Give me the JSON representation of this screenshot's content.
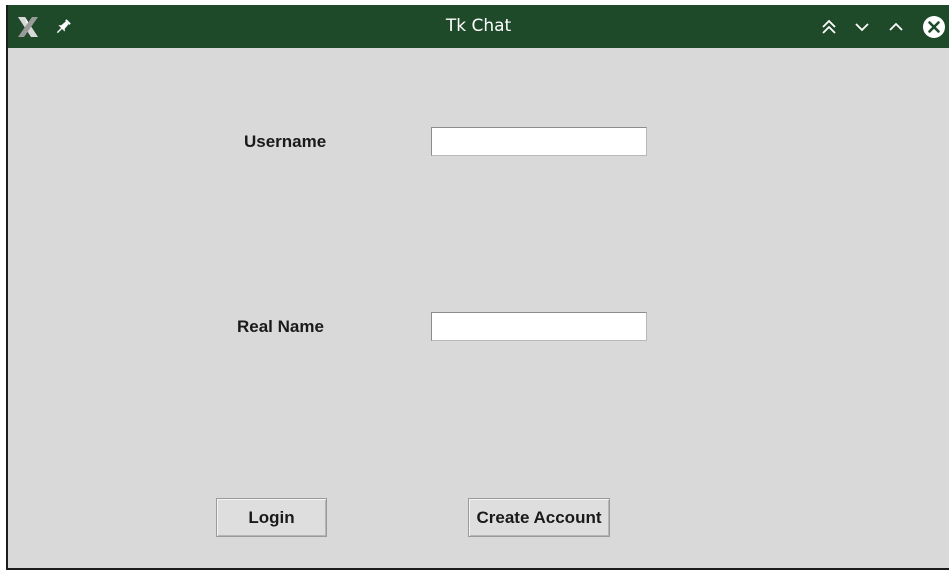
{
  "window": {
    "title": "Tk Chat",
    "titlebar_color": "#1e4a2a",
    "background_color": "#d9d9d9",
    "icons": {
      "app": "x-app-icon",
      "pin": "pin-icon",
      "shade": "double-chevron-up-icon",
      "minimize": "chevron-down-icon",
      "maximize": "chevron-up-icon",
      "close": "close-icon"
    }
  },
  "form": {
    "username_label": "Username",
    "username_value": "",
    "realname_label": "Real Name",
    "realname_value": ""
  },
  "buttons": {
    "login_label": "Login",
    "create_account_label": "Create Account"
  }
}
